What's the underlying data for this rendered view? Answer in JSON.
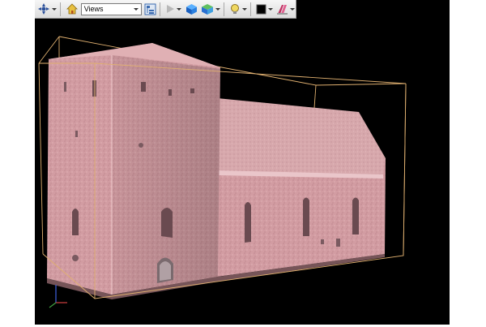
{
  "toolbar": {
    "views_select_value": "Views",
    "buttons": [
      {
        "name": "navigate-icon"
      },
      {
        "name": "home-icon"
      },
      {
        "name": "views-dropdown"
      },
      {
        "name": "view-tree-icon"
      },
      {
        "name": "play-icon"
      },
      {
        "name": "cube-blue-icon"
      },
      {
        "name": "cube-multicolor-icon"
      },
      {
        "name": "lightbulb-icon"
      },
      {
        "name": "background-color-icon"
      },
      {
        "name": "clipping-tool-icon"
      }
    ]
  },
  "viewport": {
    "background_color": "#000000",
    "bounding_box_color": "#e0b070",
    "model_color": "#d9a3a8",
    "axis_colors": {
      "x": "#d04040",
      "y": "#40a040",
      "z": "#4060e0"
    }
  }
}
